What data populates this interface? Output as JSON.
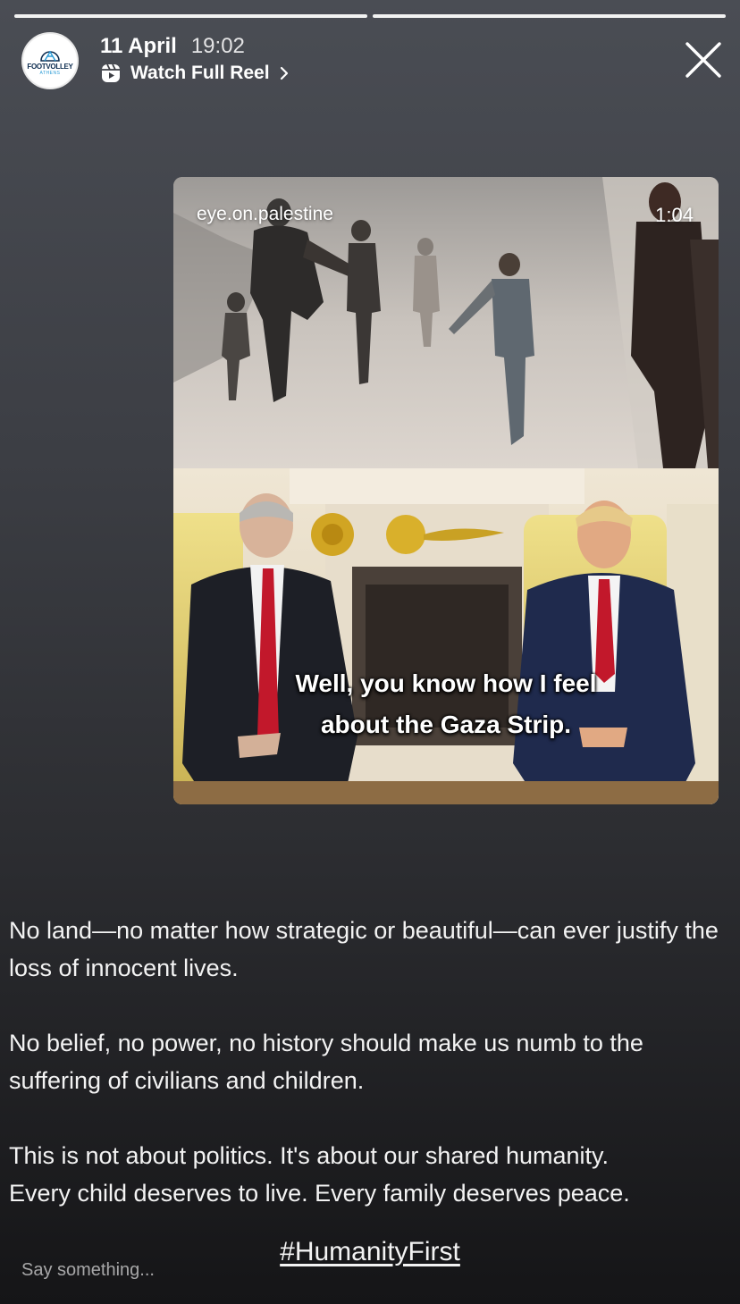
{
  "story": {
    "progress": [
      1.0,
      1.0
    ]
  },
  "header": {
    "avatar_brand": "FOOTVOLLEY",
    "avatar_sub": "ATHENS",
    "date": "11 April",
    "time": "19:02",
    "watch_label": "Watch Full Reel"
  },
  "media": {
    "handle": "eye.on.palestine",
    "duration": "1:04",
    "subtitle_line1": "Well, you know how I feel",
    "subtitle_line2": "about the Gaza Strip."
  },
  "caption": {
    "paragraph1": "No land—no matter how strategic or beautiful—can ever justify the loss of innocent lives.",
    "paragraph2": "No belief, no power, no history should make us numb to the suffering of civilians and children.",
    "paragraph3_line1": "This is not about politics. It's about our shared humanity.",
    "paragraph3_line2": "Every child deserves to live. Every family deserves peace.",
    "hashtag": "#HumanityFirst"
  },
  "reply": {
    "placeholder": "Say something..."
  },
  "colors": {
    "avatar_navy": "#0d2c4f",
    "avatar_blue": "#2a9bd6",
    "tie_red": "#c2182b",
    "suit_navy": "#1f2a4d"
  }
}
